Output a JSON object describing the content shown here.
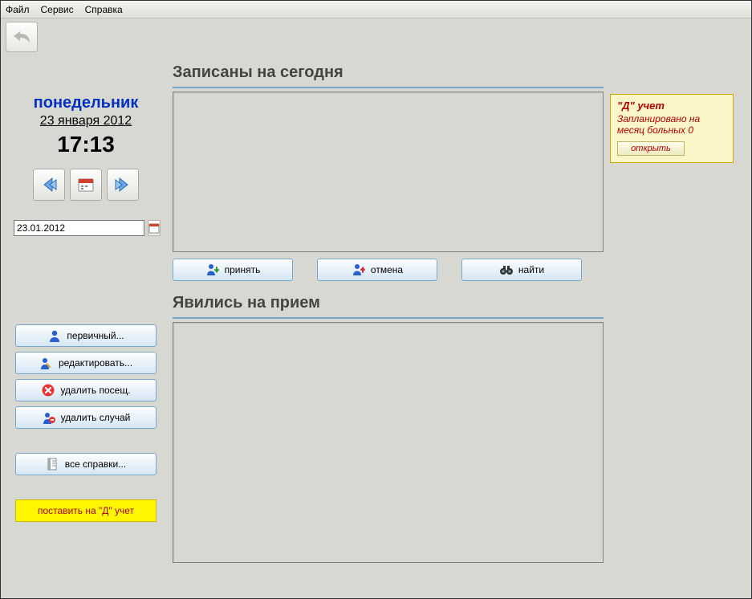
{
  "menu": {
    "file": "Файл",
    "service": "Сервис",
    "help": "Справка"
  },
  "date": {
    "day_name": "понедельник",
    "long": "23 января 2012",
    "time": "17:13",
    "input_value": "23.01.2012"
  },
  "sections": {
    "scheduled_today": "Записаны на сегодня",
    "arrived": "Явились на прием"
  },
  "actions": {
    "accept": "принять",
    "cancel": "отмена",
    "find": "найти"
  },
  "sidebar": {
    "primary": "первичный...",
    "edit": "редактировать...",
    "delete_visit": "удалить посещ.",
    "delete_case": "удалить случай",
    "all_certs": "все справки...",
    "put_on_d": "поставить на \"Д\" учет"
  },
  "note": {
    "title": "\"Д\" учет",
    "text": "Запланировано на месяц больных 0",
    "open": "открыть"
  }
}
